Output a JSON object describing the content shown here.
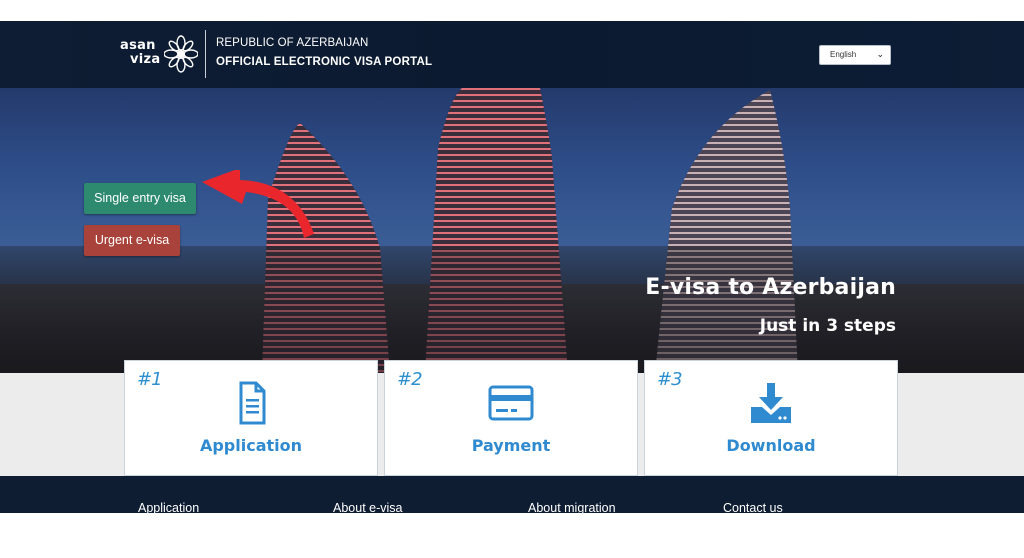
{
  "header": {
    "logo": {
      "line1": "asan",
      "line2": "viza"
    },
    "subtitle": "REPUBLIC OF AZERBAIJAN",
    "title": "OFFICIAL ELECTRONIC VISA PORTAL",
    "language": {
      "selected": "English",
      "icon": "chevron-down-icon"
    }
  },
  "hero": {
    "single_entry_label": "Single entry visa",
    "urgent_label": "Urgent e-visa",
    "title": "E-visa to Azerbaijan",
    "subtitle": "Just in 3 steps",
    "colors": {
      "single": "#2e8a6e",
      "urgent": "#a8423a",
      "arrow": "#e8262b"
    }
  },
  "steps": [
    {
      "number": "#1",
      "label": "Application",
      "icon": "document-icon"
    },
    {
      "number": "#2",
      "label": "Payment",
      "icon": "credit-card-icon"
    },
    {
      "number": "#3",
      "label": "Download",
      "icon": "download-icon"
    }
  ],
  "footer": {
    "links": [
      "Application",
      "About e-visa",
      "About migration",
      "Contact us"
    ]
  },
  "colors": {
    "accent": "#2f8ad0",
    "header_bg": "#0e1d33"
  }
}
